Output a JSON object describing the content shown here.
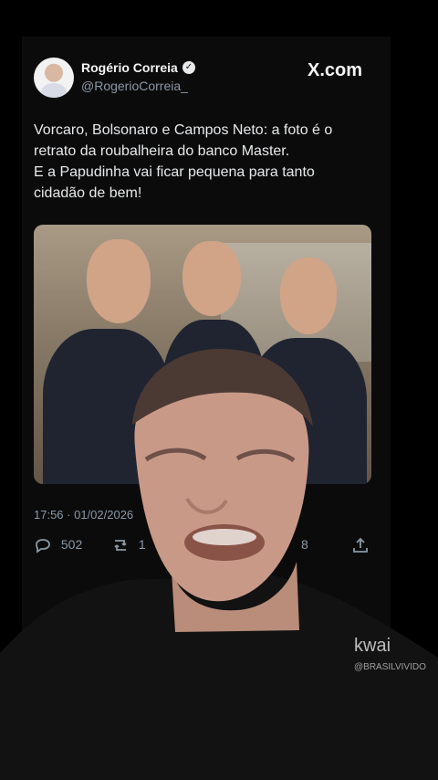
{
  "tweet": {
    "author_name": "Rogério Correia",
    "handle": "@RogerioCorreia_",
    "brand": "X.com",
    "text_lines": [
      "Vorcaro, Bolsonaro e Campos Neto: a foto é o",
      "retrato da roubalheira do banco Master.",
      "E a Papudinha vai ficar pequena para tanto",
      "cidadão de bem!"
    ],
    "timestamp": "17:56 · 01/02/2026",
    "replies": "502",
    "retweets": "1",
    "likes": "8"
  },
  "icons": {
    "verified": "verified-badge-icon",
    "reply": "reply-icon",
    "retweet": "retweet-icon",
    "share": "share-icon"
  },
  "watermark": {
    "logo": "kwai",
    "account": "@BRASILVIVIDO"
  },
  "colors": {
    "background": "#000000",
    "card": "#0b0b0c",
    "text": "#e7e9ea",
    "muted": "#8b98a5"
  }
}
